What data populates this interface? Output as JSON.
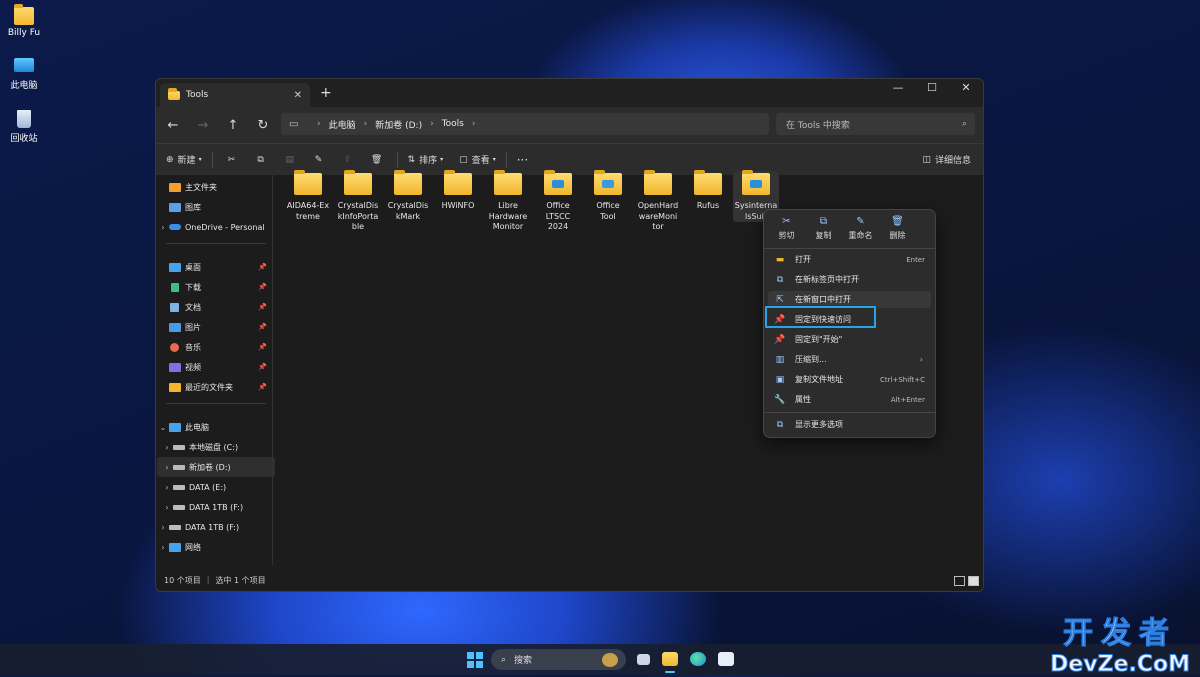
{
  "desktop": {
    "icons": [
      {
        "label": "Billy Fu",
        "icon": "folder-icon"
      },
      {
        "label": "此电脑",
        "icon": "monitor-icon"
      },
      {
        "label": "回收站",
        "icon": "recycle-bin-icon"
      }
    ]
  },
  "window": {
    "tab_title": "Tools",
    "new_tab": "+",
    "controls": {
      "minimize": "—",
      "maximize": "☐",
      "close": "✕"
    },
    "nav_buttons": {
      "back": "←",
      "forward": "→",
      "up": "↑",
      "refresh": "↻"
    },
    "breadcrumb": [
      "此电脑",
      "新加卷 (D:)",
      "Tools"
    ],
    "search_placeholder": "在 Tools 中搜索",
    "toolbar": {
      "new_label": "新建",
      "sort_label": "排序",
      "view_label": "查看",
      "more_label": "···",
      "details_label": "详细信息"
    },
    "sidebar": {
      "items": [
        {
          "label": "主文件夹",
          "icon": "home-icon",
          "color": "#f0a030"
        },
        {
          "label": "图库",
          "icon": "gallery-icon",
          "color": "#5aa0e6"
        },
        {
          "label": "OneDrive - Personal",
          "icon": "cloud-icon",
          "color": "#3a8ee6"
        },
        {
          "label": "桌面",
          "icon": "desktop-icon",
          "color": "#4aa3e8"
        },
        {
          "label": "下载",
          "icon": "download-icon",
          "color": "#3fbf7f"
        },
        {
          "label": "文档",
          "icon": "document-icon",
          "color": "#7fb3e8"
        },
        {
          "label": "图片",
          "icon": "pictures-icon",
          "color": "#4a9ae0"
        },
        {
          "label": "音乐",
          "icon": "music-icon",
          "color": "#e86a50"
        },
        {
          "label": "视频",
          "icon": "video-icon",
          "color": "#8a6ae8"
        },
        {
          "label": "最近的文件夹",
          "icon": "recent-folder-icon",
          "color": "#f0b62c"
        },
        {
          "label": "此电脑",
          "icon": "pc-icon",
          "color": "#4aa3e8"
        },
        {
          "label": "本地磁盘 (C:)",
          "icon": "drive-icon",
          "color": "#bbbbbb"
        },
        {
          "label": "新加卷 (D:)",
          "icon": "drive-icon",
          "color": "#bbbbbb"
        },
        {
          "label": "DATA (E:)",
          "icon": "drive-icon",
          "color": "#bbbbbb"
        },
        {
          "label": "DATA 1TB (F:)",
          "icon": "drive-icon",
          "color": "#bbbbbb"
        },
        {
          "label": "DATA 1TB (F:)",
          "icon": "drive-icon",
          "color": "#bbbbbb"
        },
        {
          "label": "网络",
          "icon": "network-icon",
          "color": "#4aa3e8"
        }
      ]
    },
    "files": [
      {
        "name": "AIDA64-Extreme",
        "lines": [
          "AIDA64-Ex",
          "treme"
        ],
        "badge": ""
      },
      {
        "name": "CrystalDiskInfoPortable",
        "lines": [
          "CrystalDis",
          "kInfoPorta",
          "ble"
        ],
        "badge": ""
      },
      {
        "name": "CrystalDiskMark",
        "lines": [
          "CrystalDis",
          "kMark"
        ],
        "badge": ""
      },
      {
        "name": "HWiNFO",
        "lines": [
          "HWiNFO"
        ],
        "badge": ""
      },
      {
        "name": "Libre Hardware Monitor",
        "lines": [
          "Libre",
          "Hardware",
          "Monitor"
        ],
        "badge": ""
      },
      {
        "name": "Office LTSCC 2024",
        "lines": [
          "Office",
          "LTSCC",
          "2024"
        ],
        "badge": "#2a8fd6"
      },
      {
        "name": "Office Tool",
        "lines": [
          "Office",
          "Tool"
        ],
        "badge": "#3a9ae0"
      },
      {
        "name": "OpenHardwareMonitor",
        "lines": [
          "OpenHard",
          "wareMoni",
          "tor"
        ],
        "badge": ""
      },
      {
        "name": "Rufus",
        "lines": [
          "Rufus"
        ],
        "badge": ""
      },
      {
        "name": "SysinternalsSuite",
        "lines": [
          "Sysinterna",
          "lsSuit"
        ],
        "badge": "#2a8fd6"
      }
    ],
    "status": {
      "count": "10 个项目",
      "selected": "选中 1 个项目"
    }
  },
  "context_menu": {
    "quick_actions": [
      {
        "label": "剪切",
        "icon": "scissors-icon",
        "glyph": "✂"
      },
      {
        "label": "复制",
        "icon": "copy-icon",
        "glyph": "⧉"
      },
      {
        "label": "重命名",
        "icon": "rename-icon",
        "glyph": "✎"
      },
      {
        "label": "删除",
        "icon": "trash-icon",
        "glyph": "🗑"
      }
    ],
    "items": [
      {
        "label": "打开",
        "shortcut": "Enter",
        "icon": "open-folder-icon"
      },
      {
        "label": "在新标签页中打开",
        "shortcut": "",
        "icon": "new-tab-icon"
      },
      {
        "label": "在新窗口中打开",
        "shortcut": "",
        "icon": "new-window-icon"
      },
      {
        "label": "固定到快速访问",
        "shortcut": "",
        "icon": "pin-icon"
      },
      {
        "label": "固定到\"开始\"",
        "shortcut": "",
        "icon": "pin-start-icon"
      },
      {
        "label": "压缩到...",
        "shortcut": "",
        "icon": "zip-icon"
      },
      {
        "label": "复制文件地址",
        "shortcut": "Ctrl+Shift+C",
        "icon": "copy-path-icon"
      },
      {
        "label": "属性",
        "shortcut": "Alt+Enter",
        "icon": "wrench-icon"
      },
      {
        "label": "显示更多选项",
        "shortcut": "",
        "icon": "more-options-icon"
      }
    ]
  },
  "taskbar": {
    "search_label": "搜索"
  },
  "watermark": {
    "line1": "开发者",
    "line2": "DevZe.CoM"
  }
}
